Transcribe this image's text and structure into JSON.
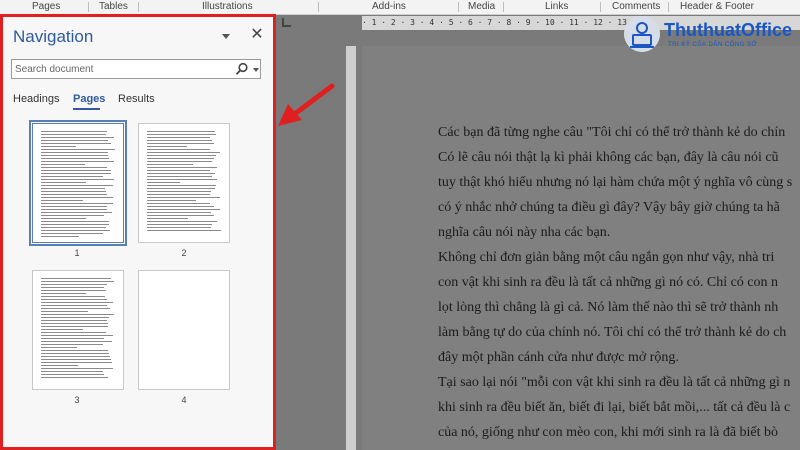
{
  "ribbon": {
    "groups": [
      "Pages",
      "Tables",
      "Illustrations",
      "Add-ins",
      "Media",
      "Links",
      "Comments",
      "Header & Footer"
    ]
  },
  "ruler": {
    "marks": "· 1 · 2 · 3 · 4 · 5 · 6 · 7 · 8 · 9 · 10 · 11 · 12 · 13"
  },
  "navigation": {
    "title": "Navigation",
    "search_placeholder": "Search document",
    "tabs": [
      "Headings",
      "Pages",
      "Results"
    ],
    "active_tab": "Pages",
    "pages": [
      {
        "number": "1",
        "selected": true
      },
      {
        "number": "2",
        "selected": false
      },
      {
        "number": "3",
        "selected": false
      },
      {
        "number": "4",
        "selected": false
      }
    ]
  },
  "document": {
    "lines": [
      "Các bạn đã từng nghe câu \"Tôi chỉ có thể trở thành kẻ do chín",
      "Có lẽ câu nói thật lạ kì phải không các bạn, đây là câu nói cũ",
      "tuy thật khó hiểu nhưng nó lại hàm chứa một ý nghĩa vô cùng s",
      "có ý nhắc nhở chúng ta điều gì đây? Vậy bây giờ chúng ta hã",
      "nghĩa câu nói này nha các bạn.",
      "Không chỉ đơn giản bằng một câu ngắn gọn như vậy, nhà tri",
      "con vật khi sinh ra đều là tất cả những gì nó có. Chỉ có con n",
      "lọt lòng thì chẳng là gì cả. Nó làm thế nào thì sẽ trở thành nh",
      "làm bằng tự do của chính nó. Tôi chỉ có thể trở thành kẻ do ch",
      "đây một phần cánh cửa như được mở rộng.",
      "Tại sao lại nói \"mỗi con vật khi sinh ra đều là tất cả những gì n",
      "khi sinh ra đều biết ăn, biết đi lại, biết bắt mồi,... tất cả đều là c",
      "của nó, giống như con mèo con, khi mới sinh ra là đã biết bò"
    ]
  },
  "logo": {
    "name": "ThuthuatOffice",
    "tagline": "TRI KỶ CỦA DÂN CÔNG SỞ"
  },
  "colors": {
    "accent": "#2e5a9e",
    "highlight_border": "#e02020",
    "logo_blue": "#1a57c2"
  }
}
